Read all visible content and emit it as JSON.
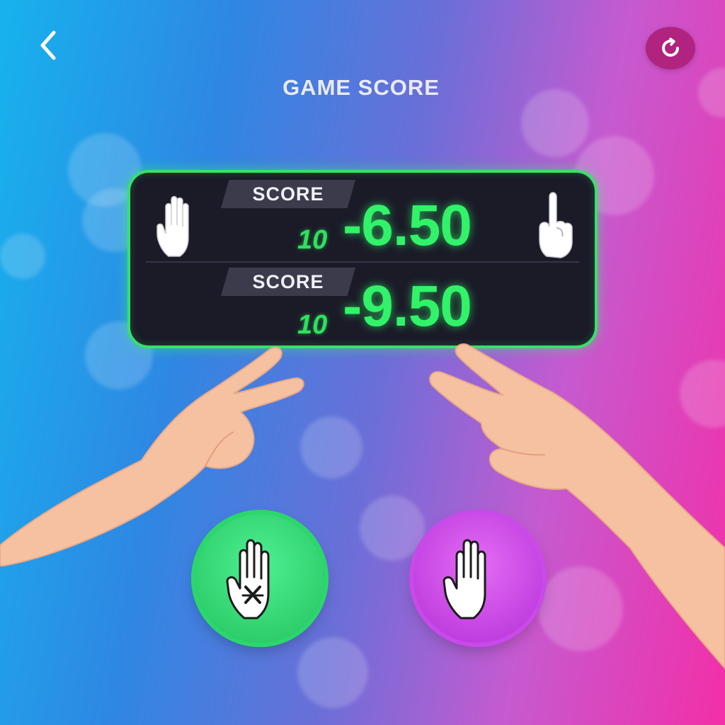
{
  "header": {
    "title": "GAME SCORE",
    "back_icon": "chevron-left-icon",
    "reset_icon": "refresh-icon"
  },
  "scoreboard": {
    "rows": [
      {
        "tag": "SCORE",
        "max": "10",
        "value": "-6.50",
        "left_icon": "open-hand-icon",
        "right_icon": "pointing-finger-icon"
      },
      {
        "tag": "SCORE",
        "max": "10",
        "value": "-9.50"
      }
    ]
  },
  "actions": [
    {
      "icon": "hand-cross-icon",
      "color": "#2ad86a"
    },
    {
      "icon": "open-hand-icon",
      "color": "#c949ea"
    }
  ],
  "colors": {
    "accent": "#32f26a",
    "panel": "#1b1b28",
    "reset_button": "#b0237f"
  }
}
